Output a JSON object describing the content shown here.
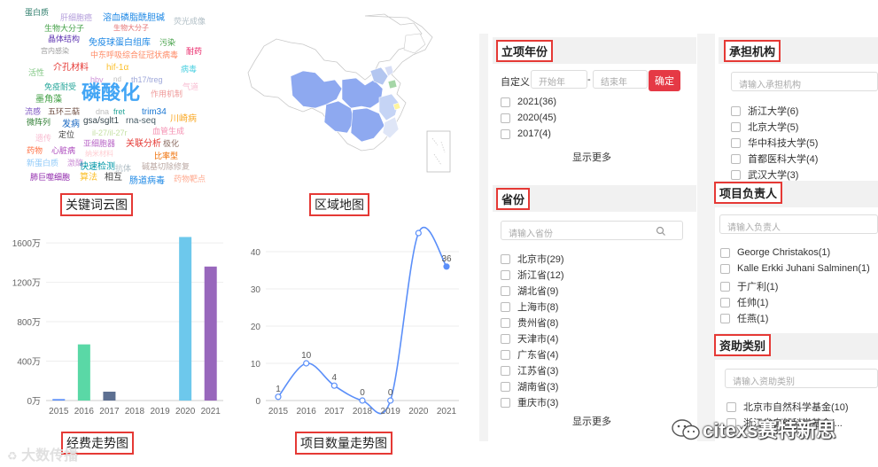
{
  "wordcloud": {
    "words": [
      {
        "text": "蛋白质",
        "color": "#2e7d6b"
      },
      {
        "text": "肝细胞癌",
        "color": "#b39ddb"
      },
      {
        "text": "溶血磷脂酰胆碱",
        "color": "#1e88e5"
      },
      {
        "text": "荧光成像",
        "color": "#b0bec5"
      },
      {
        "text": "生物大分子",
        "color": "#43a047"
      },
      {
        "text": "生物大分子",
        "color": "#e57373"
      },
      {
        "text": "免疫球蛋白",
        "color": "#8e24aa"
      },
      {
        "text": "晶体结构",
        "color": "#5e35b1"
      },
      {
        "text": "免疫球蛋白组库",
        "color": "#1e88e5"
      },
      {
        "text": "污染",
        "color": "#43a047"
      },
      {
        "text": "耐药",
        "color": "#e91e63"
      },
      {
        "text": "宫内感染",
        "color": "#9e9e9e"
      },
      {
        "text": "中东呼吸综合征冠状病毒",
        "color": "#ff8a65"
      },
      {
        "text": "活性",
        "color": "#81c784"
      },
      {
        "text": "介孔材料",
        "color": "#e53935"
      },
      {
        "text": "hif-1α",
        "color": "#fbc02d"
      },
      {
        "text": "病毒",
        "color": "#4dd0e1"
      },
      {
        "text": "hbv",
        "color": "#ce93d8"
      },
      {
        "text": "nd",
        "color": "#bdbdbd"
      },
      {
        "text": "th17/treg",
        "color": "#9fa8da"
      },
      {
        "text": "气道",
        "color": "#f8bbd0"
      },
      {
        "text": "免疫耐受",
        "color": "#26a69a"
      },
      {
        "text": "磷酸化",
        "color": "#42a5f5"
      },
      {
        "text": "作用机制",
        "color": "#ef9a9a"
      },
      {
        "text": "墨角藻",
        "color": "#43a047"
      },
      {
        "text": "流感",
        "color": "#7e57c2"
      },
      {
        "text": "五环三萜",
        "color": "#6d4c41"
      },
      {
        "text": "dna",
        "color": "#bdbdbd"
      },
      {
        "text": "fret",
        "color": "#26a69a"
      },
      {
        "text": "trim34",
        "color": "#1976d2"
      },
      {
        "text": "微阵列",
        "color": "#2e7d32"
      },
      {
        "text": "发病",
        "color": "#1565c0"
      },
      {
        "text": "gsa/sglt1",
        "color": "#37474f"
      },
      {
        "text": "rna-seq",
        "color": "#455a64"
      },
      {
        "text": "川崎病",
        "color": "#f9a825"
      },
      {
        "text": "定位",
        "color": "#424242"
      },
      {
        "text": "il-27/il-27r",
        "color": "#c5e1a5"
      },
      {
        "text": "血管生成",
        "color": "#f48fb1"
      },
      {
        "text": "遗传",
        "color": "#f8bbd0"
      },
      {
        "text": "亚细胞器",
        "color": "#ba68c8"
      },
      {
        "text": "关联分析",
        "color": "#e53935"
      },
      {
        "text": "极化",
        "color": "#8d6e63"
      },
      {
        "text": "药物",
        "color": "#ff7043"
      },
      {
        "text": "心脏病",
        "color": "#ab47bc"
      },
      {
        "text": "纳米材料",
        "color": "#ffcdd2"
      },
      {
        "text": "比率型",
        "color": "#ef6c00"
      },
      {
        "text": "新蛋白质",
        "color": "#90caf9"
      },
      {
        "text": "激酶",
        "color": "#ce93d8"
      },
      {
        "text": "快速检测",
        "color": "#0097a7"
      },
      {
        "text": "抗体",
        "color": "#b0bec5"
      },
      {
        "text": "碱基切除修复",
        "color": "#bcaaa4"
      },
      {
        "text": "肺巨噬细胞",
        "color": "#8e24aa"
      },
      {
        "text": "算法",
        "color": "#fbc02d"
      },
      {
        "text": "相互",
        "color": "#424242"
      },
      {
        "text": "肠道病毒",
        "color": "#1e88e5"
      },
      {
        "text": "药物靶点",
        "color": "#ffab91"
      }
    ],
    "caption": "关键词云图"
  },
  "map": {
    "caption": "区域地图",
    "colors": {
      "low": "#e8ecf8",
      "mid": "#b3c6f0",
      "high": "#8ea9f0",
      "accent": "#a5d6a7",
      "yellow": "#fff59d"
    }
  },
  "chart_data": [
    {
      "type": "bar",
      "title": "经费走势图",
      "categories": [
        "2015",
        "2016",
        "2017",
        "2018",
        "2019",
        "2020",
        "2021"
      ],
      "values": [
        15,
        570,
        90,
        0,
        0,
        1660,
        1360
      ],
      "colors": [
        "#5b8ff9",
        "#5ad8a6",
        "#5d7092",
        "#f6bd16",
        "#e8684a",
        "#6dc8ec",
        "#9867bc"
      ],
      "ylim": [
        0,
        1700
      ],
      "yticks": [
        "0万",
        "400万",
        "800万",
        "1200万",
        "1600万"
      ],
      "ytick_values": [
        0,
        400,
        800,
        1200,
        1600
      ],
      "grid": true
    },
    {
      "type": "line",
      "title": "项目数量走势图",
      "categories": [
        "2015",
        "2016",
        "2017",
        "2018",
        "2019",
        "2020",
        "2021"
      ],
      "values": [
        1,
        10,
        4,
        0,
        0,
        45,
        36
      ],
      "data_labels": [
        "1",
        "10",
        "4",
        "0",
        "0",
        "",
        "36"
      ],
      "color": "#5b8ff9",
      "ylim": [
        0,
        45
      ],
      "yticks": [
        "0",
        "10",
        "20",
        "30",
        "40"
      ],
      "ytick_values": [
        0,
        10,
        20,
        30,
        40
      ],
      "grid": true
    }
  ],
  "year_panel": {
    "title": "立项年份",
    "custom_label": "自定义",
    "start_placeholder": "开始年",
    "dash": "-",
    "end_placeholder": "结束年",
    "confirm": "确定",
    "items": [
      "2021(36)",
      "2020(45)",
      "2017(4)"
    ],
    "more": "显示更多"
  },
  "province_panel": {
    "title": "省份",
    "search_placeholder": "请输入省份",
    "items": [
      "北京市(29)",
      "浙江省(12)",
      "湖北省(9)",
      "上海市(8)",
      "贵州省(8)",
      "天津市(4)",
      "广东省(4)",
      "江苏省(3)",
      "湖南省(3)",
      "重庆市(3)"
    ],
    "more": "显示更多"
  },
  "org_panel": {
    "title": "承担机构",
    "search_placeholder": "请输入承担机构",
    "items": [
      "浙江大学(6)",
      "北京大学(5)",
      "华中科技大学(5)",
      "首都医科大学(4)",
      "武汉大学(3)"
    ]
  },
  "leader_panel": {
    "title": "项目负责人",
    "search_placeholder": "请输入负责人",
    "items": [
      "George Christakos(1)",
      "Kalle Erkki Juhani Salminen(1)",
      "于广利(1)",
      "任帅(1)",
      "任燕(1)"
    ]
  },
  "funding_panel": {
    "title": "资助类别",
    "search_placeholder": "请输入资助类别",
    "items": [
      "北京市自然科学基金(10)",
      "浙江省自然科学基金(..."
    ]
  },
  "watermark": {
    "left": "大数传播",
    "right": "citexs赛特新思"
  }
}
